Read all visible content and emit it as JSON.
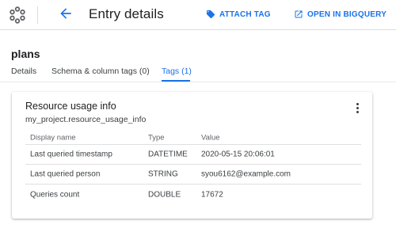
{
  "header": {
    "title": "Entry details",
    "attach_tag_label": "ATTACH TAG",
    "open_bigquery_label": "OPEN IN BIGQUERY"
  },
  "entry": {
    "name": "plans"
  },
  "tabs": [
    {
      "label": "Details",
      "active": false
    },
    {
      "label": "Schema & column tags (0)",
      "active": false
    },
    {
      "label": "Tags (1)",
      "active": true
    }
  ],
  "tag_card": {
    "title": "Resource usage info",
    "subtitle": "my_project.resource_usage_info",
    "columns": [
      "Display name",
      "Type",
      "Value"
    ],
    "rows": [
      {
        "display_name": "Last queried timestamp",
        "type": "DATETIME",
        "value": "2020-05-15 20:06:01"
      },
      {
        "display_name": "Last queried person",
        "type": "STRING",
        "value": "syou6162@example.com"
      },
      {
        "display_name": "Queries count",
        "type": "DOUBLE",
        "value": "17672"
      }
    ]
  },
  "colors": {
    "accent": "#1a73e8",
    "text": "#202124",
    "divider": "#dadce0"
  },
  "icons": {
    "logo": "data-catalog-logo-icon",
    "back": "arrow-back-icon",
    "attach_tag": "tag-icon",
    "open_bigquery": "open-in-new-icon",
    "menu": "more-vert-icon"
  }
}
